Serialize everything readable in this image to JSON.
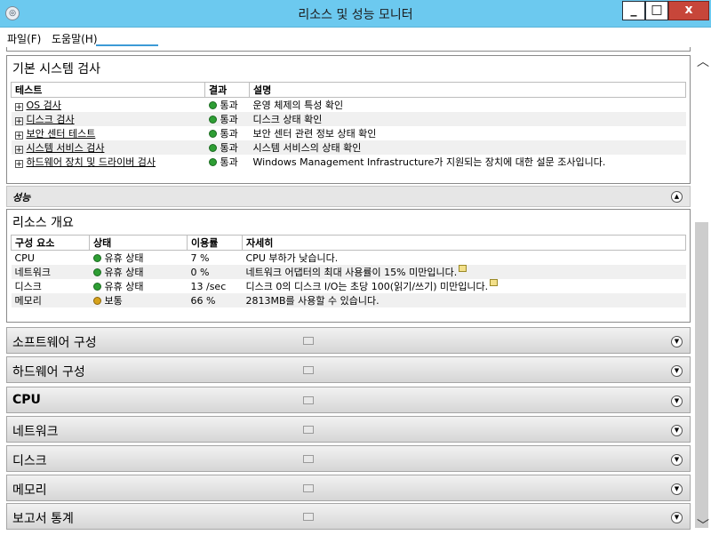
{
  "window": {
    "title": "리소스 및 성능 모니터"
  },
  "menu": {
    "file": "파일(F)",
    "help": "도움말(H)"
  },
  "basic_checks": {
    "title": "기본 시스템 검사",
    "columns": [
      "테스트",
      "결과",
      "설명"
    ],
    "rows": [
      {
        "test": "OS 검사",
        "result": "통과",
        "description": "운영 체제의 특성 확인"
      },
      {
        "test": "디스크 검사",
        "result": "통과",
        "description": "디스크 상태 확인"
      },
      {
        "test": "보안 센터 테스트",
        "result": "통과",
        "description": "보안 센터 관련 정보 상태 확인"
      },
      {
        "test": "시스템 서비스 검사",
        "result": "통과",
        "description": "시스템 서비스의 상태 확인"
      },
      {
        "test": "하드웨어 장치 및 드라이버 검사",
        "result": "통과",
        "description": "Windows Management Infrastructure가 지원되는 장치에 대한 설문 조사입니다."
      }
    ]
  },
  "performance": {
    "label": "성능"
  },
  "resource_overview": {
    "title": "리소스 개요",
    "columns": [
      "구성 요소",
      "상태",
      "이용률",
      "자세히"
    ],
    "rows": [
      {
        "component": "CPU",
        "status": "유휴 상태",
        "status_color": "#2e9e34",
        "usage": "7 %",
        "detail": "CPU 부하가 낮습니다."
      },
      {
        "component": "네트워크",
        "status": "유휴 상태",
        "status_color": "#2e9e34",
        "usage": "0 %",
        "detail": "네트워크 어댑터의 최대 사용률이 15% 미만입니다."
      },
      {
        "component": "디스크",
        "status": "유휴 상태",
        "status_color": "#2e9e34",
        "usage": "13 /sec",
        "detail": "디스크 0의 디스크 I/O는 초당 100(읽기/쓰기) 미만입니다."
      },
      {
        "component": "메모리",
        "status": "보통",
        "status_color": "#d6a21b",
        "usage": "66 %",
        "detail": "2813MB를 사용할 수 있습니다."
      }
    ]
  },
  "sections": [
    {
      "label": "소프트웨어 구성"
    },
    {
      "label": "하드웨어 구성"
    },
    {
      "label": "CPU"
    },
    {
      "label": "네트워크"
    },
    {
      "label": "디스크"
    },
    {
      "label": "메모리"
    },
    {
      "label": "보고서 통계"
    }
  ]
}
